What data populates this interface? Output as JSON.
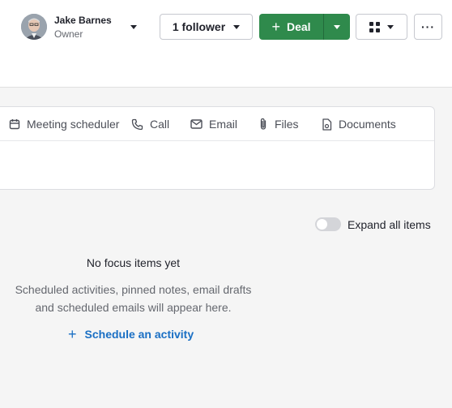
{
  "owner": {
    "name": "Jake Barnes",
    "role": "Owner",
    "avatar_icon": "user-avatar"
  },
  "toolbar": {
    "follower_label": "1 follower",
    "deal_label": "Deal",
    "deal_color": "#2f8a4c",
    "more_label": "···"
  },
  "tabs": [
    {
      "label": "Meeting scheduler",
      "icon": "calendar-icon"
    },
    {
      "label": "Call",
      "icon": "phone-icon"
    },
    {
      "label": "Email",
      "icon": "envelope-icon"
    },
    {
      "label": "Files",
      "icon": "paperclip-icon"
    },
    {
      "label": "Documents",
      "icon": "document-icon"
    }
  ],
  "focus": {
    "expand_label": "Expand all items",
    "expand_on": false,
    "empty_title": "No focus items yet",
    "empty_desc_line1": "Scheduled activities, pinned notes, email drafts",
    "empty_desc_line2": "and scheduled emails will appear here.",
    "schedule_label": "Schedule an activity",
    "link_color": "#1a6fc4"
  }
}
